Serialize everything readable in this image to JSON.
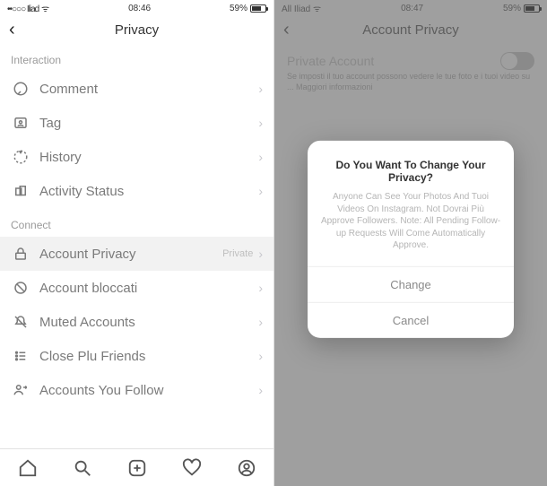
{
  "left": {
    "status": {
      "carrier": "••○○○ Iliad",
      "wifi": "wifi",
      "time": "08:46",
      "battery_pct": "59%",
      "battery_icon": "battery"
    },
    "nav": {
      "back": "‹",
      "title": "Privacy"
    },
    "sections": {
      "interaction": {
        "label": "Interaction",
        "items": [
          {
            "name": "comment",
            "label": "Comment"
          },
          {
            "name": "tag",
            "label": "Tag"
          },
          {
            "name": "history",
            "label": "History"
          },
          {
            "name": "activity-status",
            "label": "Activity Status"
          }
        ]
      },
      "connect": {
        "label": "Connect",
        "items": [
          {
            "name": "account-privacy",
            "label": "Account Privacy",
            "detail": "Private"
          },
          {
            "name": "blocked-accounts",
            "label": "Account bloccati"
          },
          {
            "name": "muted-accounts",
            "label": "Muted Accounts"
          },
          {
            "name": "close-friends",
            "label": "Close Plu Friends"
          },
          {
            "name": "accounts-you-follow",
            "label": "Accounts You Follow"
          }
        ]
      }
    }
  },
  "right": {
    "status": {
      "carrier": "All Iliad",
      "wifi": "wifi",
      "time": "08:47",
      "battery_pct": "59%",
      "battery_icon": "battery"
    },
    "nav": {
      "back": "‹",
      "title": "Account Privacy"
    },
    "background": {
      "switch_label": "Private Account",
      "desc": "Se imposti il tuo account possono vedere le tue foto e i tuoi video su ... Maggiori informazioni"
    },
    "dialog": {
      "title": "Do You Want To Change Your Privacy?",
      "body": "Anyone Can See Your Photos And Tuoi Videos On Instagram. Not Dovrai Più Approve Followers. Note: All Pending Follow-up Requests Will Come Automatically Approve.",
      "change": "Change",
      "cancel": "Cancel"
    }
  }
}
